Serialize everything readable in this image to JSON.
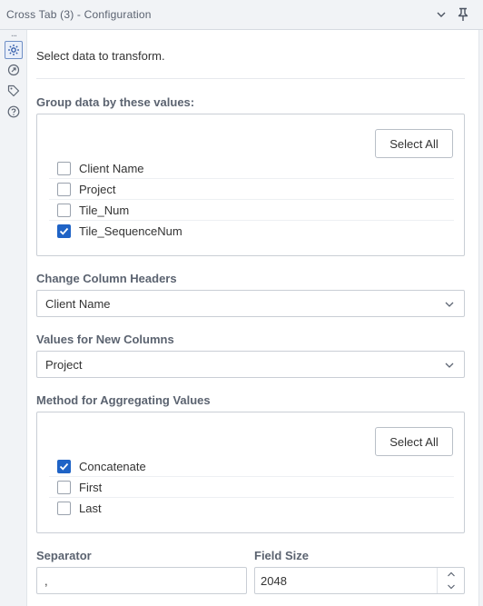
{
  "window": {
    "title": "Cross Tab (3) - Configuration",
    "overflow_dots": "..."
  },
  "icons": {
    "collapse": "chevron-down-icon",
    "pin": "pin-icon",
    "configuration": "gear-icon",
    "annotation": "annotation-icon",
    "tag": "tag-icon",
    "help": "help-icon"
  },
  "intro": "Select data to transform.",
  "group_by": {
    "label": "Group data by these values:",
    "select_all_label": "Select All",
    "items": [
      {
        "label": "Client Name",
        "checked": false
      },
      {
        "label": "Project",
        "checked": false
      },
      {
        "label": "Tile_Num",
        "checked": false
      },
      {
        "label": "Tile_SequenceNum",
        "checked": true
      }
    ]
  },
  "column_headers": {
    "label": "Change Column Headers",
    "value": "Client Name"
  },
  "values_new_columns": {
    "label": "Values for New Columns",
    "value": "Project"
  },
  "aggregation": {
    "label": "Method for Aggregating Values",
    "select_all_label": "Select All",
    "items": [
      {
        "label": "Concatenate",
        "checked": true
      },
      {
        "label": "First",
        "checked": false
      },
      {
        "label": "Last",
        "checked": false
      }
    ]
  },
  "separator": {
    "label": "Separator",
    "value": ","
  },
  "field_size": {
    "label": "Field Size",
    "value": "2048"
  },
  "colors": {
    "accent": "#1f63c6",
    "panel_bg": "#f1f3f6",
    "border": "#c9ced5",
    "label": "#5b6370"
  }
}
